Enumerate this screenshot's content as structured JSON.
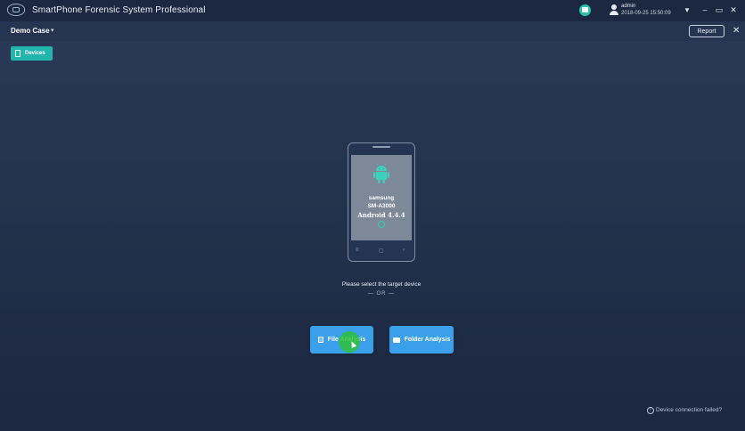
{
  "app": {
    "title": "SmartPhone Forensic System Professional"
  },
  "user": {
    "name": "admin",
    "datetime": "2018-09-25 15:50:09"
  },
  "window_controls": {
    "menu": "▾",
    "minimize": "–",
    "maximize": "▭",
    "close": "✕"
  },
  "case": {
    "name": "Demo Case",
    "arrow": "▾",
    "report_label": "Report",
    "close": "✕"
  },
  "toolbar": {
    "devices_label": "Devices"
  },
  "device": {
    "brand": "samsung",
    "model": "SM-A3000",
    "os": "Android 4.4.4",
    "nav_menu": "≡",
    "nav_home": "▢",
    "nav_back": "‹"
  },
  "main": {
    "hint": "Please select the target device",
    "or": "— OR —",
    "file_analysis_label": "File Analysis",
    "folder_analysis_label": "Folder Analysis"
  },
  "footer": {
    "connection_failed": "Device connection failed?",
    "info_glyph": "!"
  },
  "colors": {
    "accent_teal": "#22b5ad",
    "button_blue": "#3aa0ec",
    "background": "#24324d"
  }
}
